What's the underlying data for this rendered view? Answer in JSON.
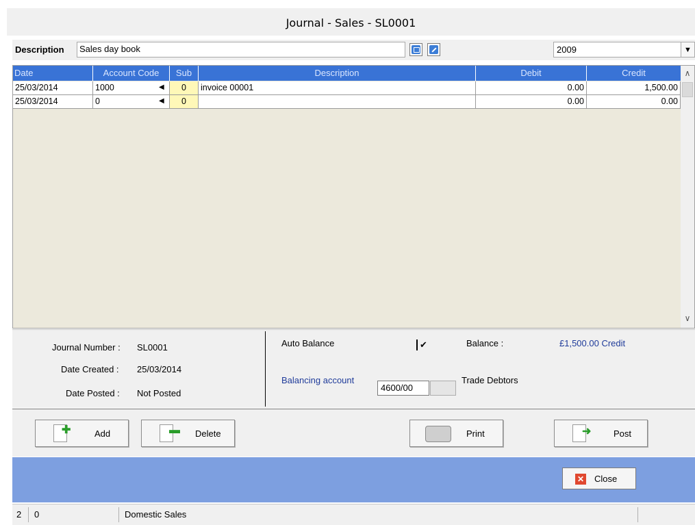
{
  "window": {
    "title": "Journal - Sales - SL0001"
  },
  "header": {
    "description_label": "Description",
    "description_value": "Sales day book",
    "year": "2009"
  },
  "grid": {
    "columns": [
      "Date",
      "Account Code",
      "Sub",
      "Description",
      "Debit",
      "Credit"
    ],
    "rows": [
      {
        "date": "25/03/2014",
        "account": "1000",
        "sub": "0",
        "description": "invoice 00001",
        "debit": "0.00",
        "credit": "1,500.00"
      },
      {
        "date": "25/03/2014",
        "account": "0",
        "sub": "0",
        "description": "",
        "debit": "0.00",
        "credit": "0.00"
      }
    ]
  },
  "info": {
    "journal_number_label": "Journal Number :",
    "journal_number": "SL0001",
    "date_created_label": "Date Created :",
    "date_created": "25/03/2014",
    "date_posted_label": "Date Posted :",
    "date_posted": "Not Posted",
    "auto_balance_label": "Auto Balance",
    "auto_balance_checked": true,
    "balance_label": "Balance :",
    "balance_value": "£1,500.00 Credit",
    "balancing_account_label": "Balancing account",
    "balancing_account_value": "4600/00",
    "balancing_account_name": "Trade Debtors"
  },
  "buttons": {
    "add": "Add",
    "delete": "Delete",
    "print": "Print",
    "post": "Post",
    "close": "Close"
  },
  "status_bar": {
    "field1": "2",
    "field2": "0",
    "field3": "Domestic Sales"
  },
  "colors": {
    "grid_header": "#3973d6",
    "band": "#7d9fe0",
    "sub_cell": "#fff8b8",
    "link_text": "#1f3b9a"
  }
}
